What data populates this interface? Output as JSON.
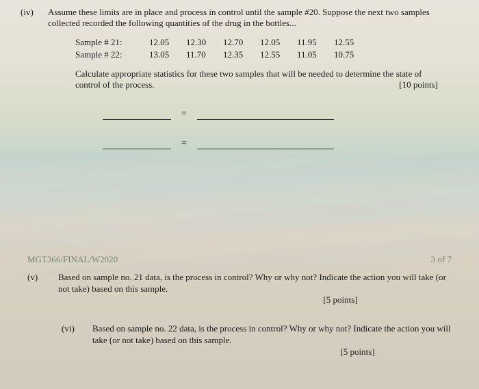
{
  "q_iv": {
    "marker": "(iv)",
    "text": "Assume these limits are in place and process in control until the sample #20. Suppose the next two samples collected recorded the following quantities of the drug in the bottles...",
    "samples": {
      "row1": {
        "label": "Sample # 21:",
        "vals": [
          "12.05",
          "12.30",
          "12.70",
          "12.05",
          "11.95",
          "12.55"
        ]
      },
      "row2": {
        "label": "Sample # 22:",
        "vals": [
          "13.05",
          "11.70",
          "12.35",
          "12.55",
          "11.05",
          "10.75"
        ]
      }
    },
    "calc": "Calculate appropriate statistics for these two samples that will be needed to determine the state of control of the process.",
    "points": "[10 points]",
    "equals": "="
  },
  "footer": {
    "course": "MGT366/FINAL/W2020",
    "page": "3 of 7"
  },
  "q_v": {
    "marker": "(v)",
    "text": "Based on sample no. 21 data, is the process in control? Why or why not?   Indicate the action you will take (or not take) based on this sample.",
    "points": "[5 points]"
  },
  "q_vi": {
    "marker": "(vi)",
    "text": "Based on sample no. 22 data, is the process in control? Why or why not?   Indicate the action you will take (or not take) based on this sample.",
    "points": "[5 points]"
  }
}
